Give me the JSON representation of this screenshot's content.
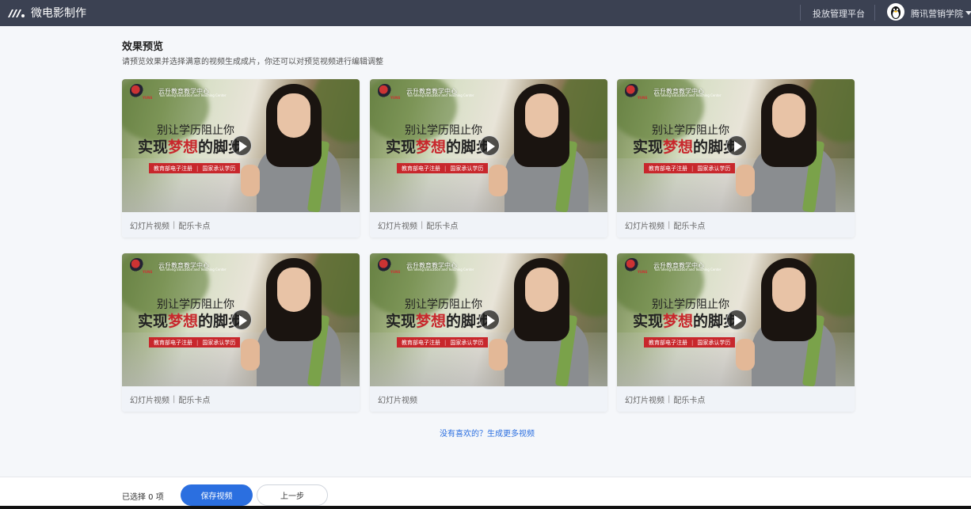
{
  "app": {
    "title": "微电影制作"
  },
  "topbar": {
    "nav_link": "投放管理平台",
    "user_name": "腾讯营销学院"
  },
  "header": {
    "title": "效果预览",
    "subtitle": "请预览效果并选择满意的视频生成成片，你还可以对预览视频进行编辑调整"
  },
  "thumbnail": {
    "brand_name": "云升教育教学中心",
    "brand_sub": "Yun Sheng Education and Teaching Center",
    "brand_small": "YUNS",
    "slogan_line1": "别让学历阻止你",
    "slogan_line2_a": "实现",
    "slogan_line2_b": "梦想",
    "slogan_line2_c": "的脚步",
    "ribbon_left": "教育部电子注册",
    "ribbon_sep": "|",
    "ribbon_right": "国家承认学历"
  },
  "cards": [
    {
      "tag1": "幻灯片视频",
      "sep": "|",
      "tag2": "配乐卡点",
      "highlight": true
    },
    {
      "tag1": "幻灯片视频",
      "sep": "|",
      "tag2": "配乐卡点",
      "highlight": false
    },
    {
      "tag1": "幻灯片视频",
      "sep": "|",
      "tag2": "配乐卡点",
      "highlight": false
    },
    {
      "tag1": "幻灯片视频",
      "sep": "|",
      "tag2": "配乐卡点",
      "highlight": false
    },
    {
      "tag1": "幻灯片视频",
      "sep": "",
      "tag2": "",
      "highlight": false
    },
    {
      "tag1": "幻灯片视频",
      "sep": "|",
      "tag2": "配乐卡点",
      "highlight": false
    }
  ],
  "more_link": "没有喜欢的？生成更多视频",
  "bottom": {
    "selected_text": "已选择 0 项",
    "save_label": "保存视频",
    "back_label": "上一步"
  },
  "colors": {
    "topbar": "#3b4152",
    "primary": "#2b6fe0",
    "highlight_border": "#e2382b",
    "brand_red": "#c8272c"
  }
}
